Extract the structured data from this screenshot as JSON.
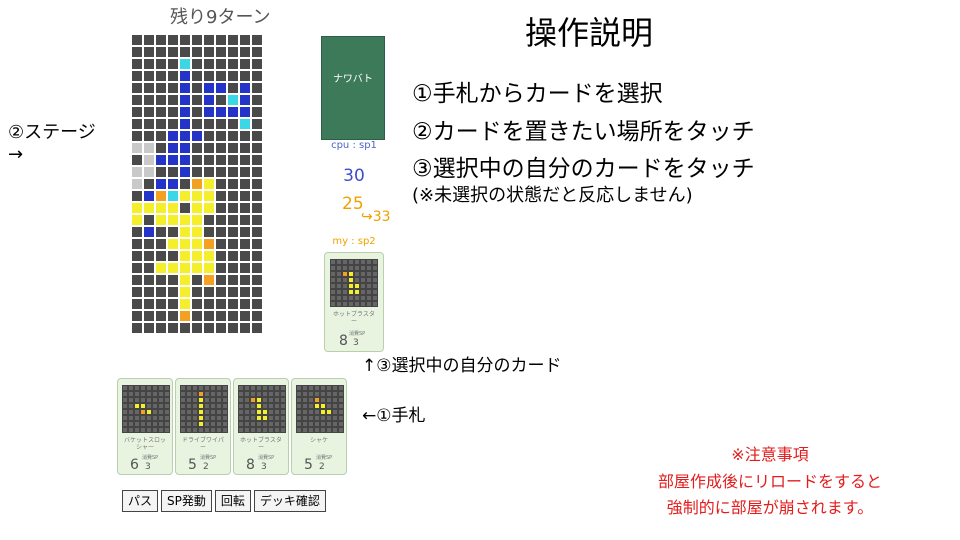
{
  "turns_left": "残り9ターン",
  "title": "操作説明",
  "instructions": [
    "①手札からカードを選択",
    "②カードを置きたい場所をタッチ",
    "③選択中の自分のカードをタッチ"
  ],
  "instruction_note": "(※未選択の状態だと反応しません)",
  "stage_label": "②ステージ",
  "stage_arrow": "→",
  "selected_card_label": "↑③選択中の自分のカード",
  "hand_label": "←①手札",
  "warning": {
    "title": "※注意事項",
    "line1": "部屋作成後にリロードをすると",
    "line2": "強制的に部屋が崩されます。"
  },
  "cpu": {
    "card_name": "ナワバト",
    "sp": "cpu : sp1",
    "score": "30"
  },
  "my": {
    "sp": "my : sp2",
    "score": "25",
    "score_next": "↪33"
  },
  "selected_card": {
    "name": "ホットブラスター",
    "cost": "8",
    "sp_label": "消費SP",
    "sp": "3"
  },
  "hand": [
    {
      "name": "バケットスロッシャー",
      "cost": "6",
      "sp_label": "消費SP",
      "sp": "3"
    },
    {
      "name": "ドライブワイパー",
      "cost": "5",
      "sp_label": "消費SP",
      "sp": "2"
    },
    {
      "name": "ホットブラスター",
      "cost": "8",
      "sp_label": "消費SP",
      "sp": "3"
    },
    {
      "name": "シャケ",
      "cost": "5",
      "sp_label": "消費SP",
      "sp": "2"
    }
  ],
  "buttons": [
    "パス",
    "SP発動",
    "回転",
    "デッキ確認"
  ],
  "colors": {
    "empty": "#4a4a4a",
    "cpu_ink": "#2433c8",
    "cpu_special": "#3ad7e6",
    "my_ink": "#f5ee2a",
    "my_special": "#f4a020",
    "wall": "#c9c9c9",
    "warning": "#e41c1c"
  }
}
